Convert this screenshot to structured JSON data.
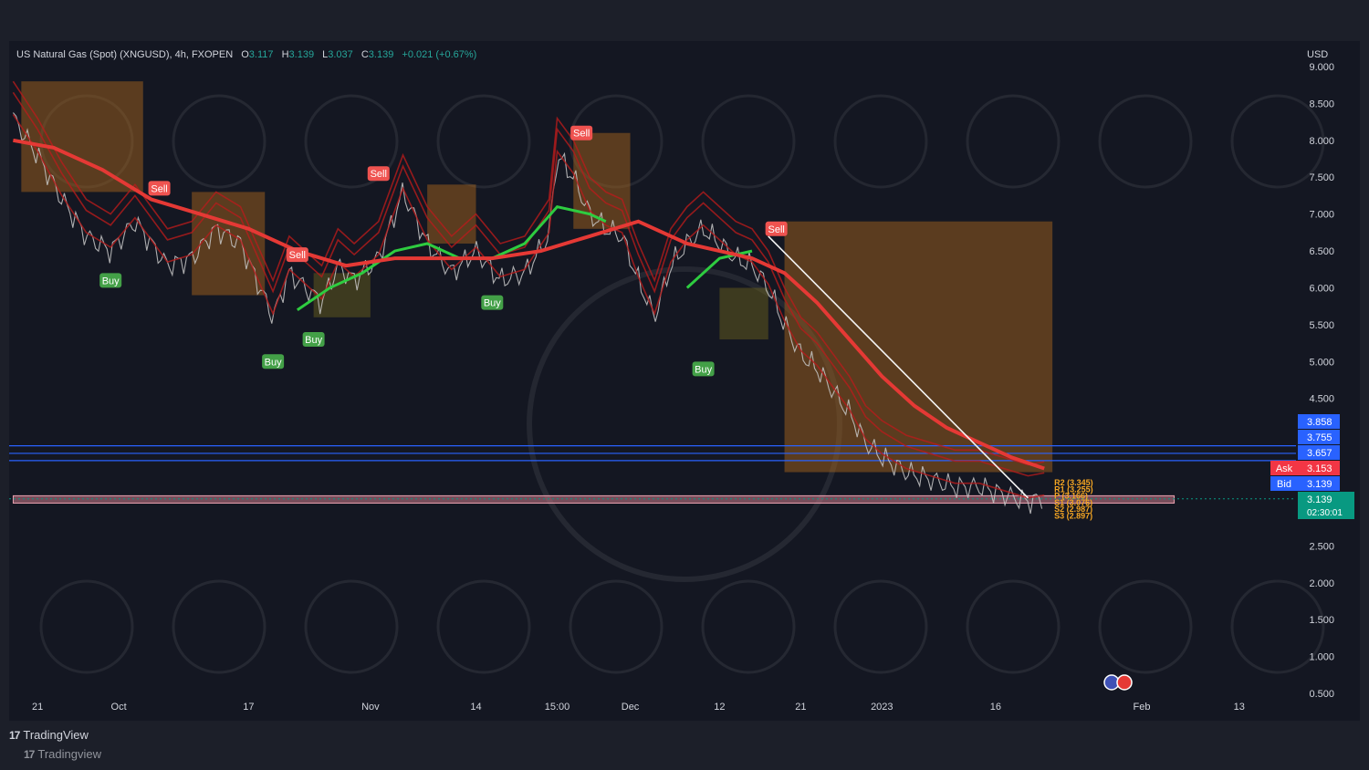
{
  "legend": {
    "symbol": "US Natural Gas (Spot) (XNGUSD), 4h, FXOPEN",
    "o_label": "O",
    "o_value": "3.117",
    "h_label": "H",
    "h_value": "3.139",
    "l_label": "L",
    "l_value": "3.037",
    "c_label": "C",
    "c_value": "3.139",
    "change": "+0.021 (+0.67%)"
  },
  "currency": "USD",
  "brand": {
    "logo_mark": "17",
    "name": "TradingView",
    "ghost_name": "Tradingview"
  },
  "colors": {
    "up": "#26a69a",
    "down": "#ef5350",
    "ema": "#e53935",
    "sell": "#ef5350",
    "buy": "#43a047",
    "ask": "#f23645",
    "bid": "#2962ff",
    "last": "#089981"
  },
  "chart_data": {
    "type": "line",
    "title": "US Natural Gas (Spot) (XNGUSD), 4h, FXOPEN",
    "ylim": [
      0.5,
      9.0
    ],
    "y_ticks": [
      "9.000",
      "8.500",
      "8.000",
      "7.500",
      "7.000",
      "6.500",
      "6.000",
      "5.500",
      "5.000",
      "4.500",
      "2.500",
      "2.000",
      "1.500",
      "1.000",
      "0.500"
    ],
    "y_tick_values": [
      9.0,
      8.5,
      8.0,
      7.5,
      7.0,
      6.5,
      6.0,
      5.5,
      5.0,
      4.5,
      2.5,
      2.0,
      1.5,
      1.0,
      0.5
    ],
    "x_tick_labels": [
      "21",
      "Oct",
      "17",
      "Nov",
      "14",
      "15:00",
      "Dec",
      "12",
      "21",
      "2023",
      "16",
      "Feb",
      "13"
    ],
    "x_tick_days": [
      0,
      10,
      26,
      41,
      54,
      64,
      73,
      84,
      94,
      104,
      118,
      136,
      148
    ],
    "x_range_days": [
      -3.5,
      155
    ],
    "price_series": {
      "name": "XNGUSD",
      "x_days": [
        -3,
        0,
        3,
        6,
        9,
        12,
        14,
        16,
        19,
        22,
        25,
        27,
        29,
        31,
        33,
        35,
        37,
        39,
        42,
        45,
        48,
        51,
        54,
        57,
        60,
        63,
        64,
        66,
        68,
        70,
        72,
        74,
        76,
        78,
        80,
        82,
        84,
        86,
        88,
        90,
        92,
        94,
        96,
        98,
        100,
        102,
        104,
        107,
        110,
        113,
        116,
        119,
        122,
        124
      ],
      "values": [
        8.3,
        7.8,
        7.2,
        6.7,
        6.5,
        6.9,
        6.6,
        6.3,
        6.4,
        6.8,
        6.6,
        6.1,
        5.6,
        6.2,
        6.0,
        5.8,
        6.3,
        6.1,
        6.4,
        7.3,
        6.6,
        6.2,
        6.5,
        6.1,
        6.2,
        6.7,
        7.8,
        7.5,
        7.0,
        6.8,
        6.7,
        6.1,
        5.6,
        6.3,
        6.6,
        6.8,
        6.6,
        6.4,
        6.3,
        6.0,
        5.5,
        5.1,
        4.9,
        4.6,
        4.3,
        3.9,
        3.7,
        3.5,
        3.4,
        3.3,
        3.3,
        3.2,
        3.1,
        3.14
      ]
    },
    "ema_series": {
      "name": "EMA",
      "x_days": [
        -3,
        2,
        8,
        14,
        20,
        26,
        32,
        38,
        44,
        50,
        56,
        62,
        68,
        74,
        80,
        84,
        88,
        92,
        96,
        100,
        104,
        108,
        112,
        116,
        120,
        124
      ],
      "values": [
        8.0,
        7.9,
        7.6,
        7.2,
        7.0,
        6.8,
        6.5,
        6.3,
        6.4,
        6.4,
        6.4,
        6.5,
        6.7,
        6.9,
        6.6,
        6.5,
        6.4,
        6.2,
        5.8,
        5.3,
        4.8,
        4.4,
        4.1,
        3.9,
        3.7,
        3.55
      ]
    },
    "bull_lines": [
      {
        "x_days": [
          32,
          36,
          40,
          44,
          48,
          52
        ],
        "values": [
          5.7,
          6.0,
          6.2,
          6.5,
          6.6,
          6.4
        ]
      },
      {
        "x_days": [
          56,
          60,
          64,
          68,
          70
        ],
        "values": [
          6.4,
          6.6,
          7.1,
          7.0,
          6.9
        ]
      },
      {
        "x_days": [
          80,
          84,
          88
        ],
        "values": [
          6.0,
          6.4,
          6.5
        ]
      }
    ],
    "trend_line": {
      "x_days": [
        90,
        122
      ],
      "values": [
        6.7,
        3.15
      ]
    },
    "supply_zones": [
      {
        "x_days": [
          -2,
          13
        ],
        "values": [
          8.8,
          7.3
        ]
      },
      {
        "x_days": [
          19,
          28
        ],
        "values": [
          7.3,
          5.9
        ]
      },
      {
        "x_days": [
          48,
          54
        ],
        "values": [
          7.4,
          6.6
        ]
      },
      {
        "x_days": [
          66,
          73
        ],
        "values": [
          8.1,
          6.8
        ]
      },
      {
        "x_days": [
          92,
          125
        ],
        "values": [
          6.9,
          3.5
        ]
      }
    ],
    "demand_zones": [
      {
        "x_days": [
          34,
          41
        ],
        "values": [
          6.2,
          5.6
        ]
      },
      {
        "x_days": [
          84,
          90
        ],
        "values": [
          6.0,
          5.3
        ]
      }
    ],
    "support_band": {
      "x_days": [
        -3,
        140
      ],
      "values": [
        3.18,
        3.08
      ]
    },
    "horizontal_lines": [
      3.858,
      3.755,
      3.657
    ],
    "signals": [
      {
        "label": "Sell",
        "x_day": 15,
        "value": 7.35
      },
      {
        "label": "Sell",
        "x_day": 32,
        "value": 6.45
      },
      {
        "label": "Sell",
        "x_day": 42,
        "value": 7.55
      },
      {
        "label": "Sell",
        "x_day": 67,
        "value": 8.1
      },
      {
        "label": "Sell",
        "x_day": 91,
        "value": 6.8
      },
      {
        "label": "Buy",
        "x_day": 9,
        "value": 6.1
      },
      {
        "label": "Buy",
        "x_day": 29,
        "value": 5.0
      },
      {
        "label": "Buy",
        "x_day": 34,
        "value": 5.3
      },
      {
        "label": "Buy",
        "x_day": 56,
        "value": 5.8
      },
      {
        "label": "Buy",
        "x_day": 82,
        "value": 4.9
      }
    ],
    "pivot_labels": [
      "R2 (3.345)",
      "R1 (3.255)",
      "P (3.166)",
      "S1 (3.076)",
      "S2 (2.987)",
      "S3 (2.897)"
    ],
    "pivot_values": [
      3.345,
      3.255,
      3.166,
      3.076,
      2.987,
      2.897
    ],
    "price_tags": [
      {
        "label": "",
        "value": "3.858",
        "color": "#2962ff"
      },
      {
        "label": "",
        "value": "3.755",
        "color": "#2962ff"
      },
      {
        "label": "",
        "value": "3.657",
        "color": "#2962ff"
      },
      {
        "label": "Ask",
        "value": "3.153",
        "color": "#f23645"
      },
      {
        "label": "Bid",
        "value": "3.139",
        "color": "#2962ff"
      },
      {
        "label": "",
        "value": "3.139",
        "color": "#089981",
        "sub": "02:30:01"
      }
    ]
  }
}
